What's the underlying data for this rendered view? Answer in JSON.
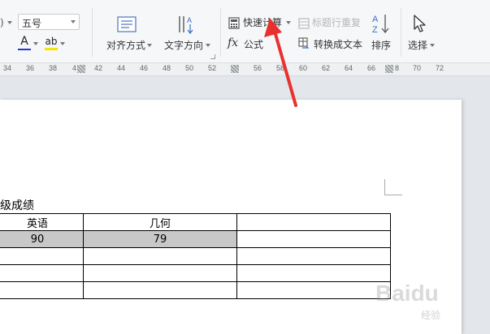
{
  "ribbon": {
    "font_size": "五号",
    "align_label": "对齐方式",
    "text_direction_label": "文字方向",
    "quick_calc_label": "快速计算",
    "title_repeat_label": "标题行重复",
    "formula_label": "公式",
    "convert_text_label": "转换成文本",
    "sort_label": "排序",
    "select_label": "选择",
    "fx_glyph": "fx"
  },
  "ruler": {
    "labels": [
      "34",
      "36",
      "38",
      "4",
      "42",
      "44",
      "46",
      "48",
      "50",
      "52",
      "56",
      "58",
      "60",
      "62",
      "64",
      "66",
      "8",
      "70",
      "72"
    ]
  },
  "document": {
    "caption": "级成绩",
    "table": {
      "headers": [
        "英语",
        "几何",
        ""
      ],
      "rows": [
        [
          "90",
          "79",
          ""
        ],
        [
          "",
          "",
          ""
        ],
        [
          "",
          "",
          ""
        ],
        [
          "",
          "",
          ""
        ]
      ]
    }
  },
  "watermark": {
    "text": "Baidu",
    "sub": "经验"
  },
  "colors": {
    "arrow": "#e8312f",
    "highlight": "#c8c8c8",
    "font_color_bar": "#1e3bd6",
    "highlight_bar": "#f3e600"
  }
}
